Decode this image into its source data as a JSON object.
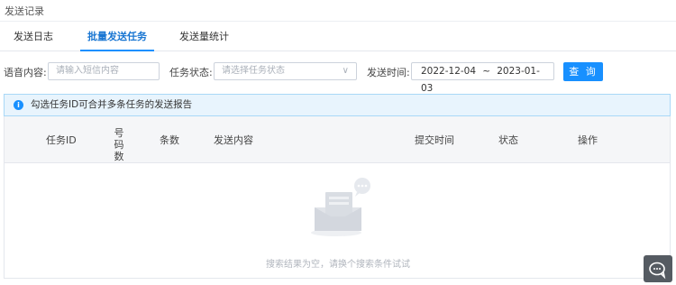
{
  "page_title": "发送记录",
  "tabs": [
    {
      "label": "发送日志",
      "active": false
    },
    {
      "label": "批量发送任务",
      "active": true
    },
    {
      "label": "发送量统计",
      "active": false
    }
  ],
  "filters": {
    "content_label": "语音内容:",
    "content_placeholder": "请输入短信内容",
    "status_label": "任务状态:",
    "status_placeholder": "请选择任务状态",
    "time_label": "发送时间:",
    "date_start": "2022-12-04",
    "date_sep": "~",
    "date_end": "2023-01-03",
    "query_label": "查 询"
  },
  "notice": {
    "icon": "info-icon",
    "text": "勾选任务ID可合并多条任务的发送报告"
  },
  "table": {
    "columns": [
      "任务ID",
      "号码数",
      "条数",
      "发送内容",
      "提交时间",
      "状态",
      "操作"
    ],
    "rows": [],
    "empty_text": "搜索结果为空，请换个搜索条件试试"
  },
  "colors": {
    "accent": "#1890ff",
    "notice_bg": "#e8f4fd",
    "header_bg": "#f5f6f8"
  }
}
